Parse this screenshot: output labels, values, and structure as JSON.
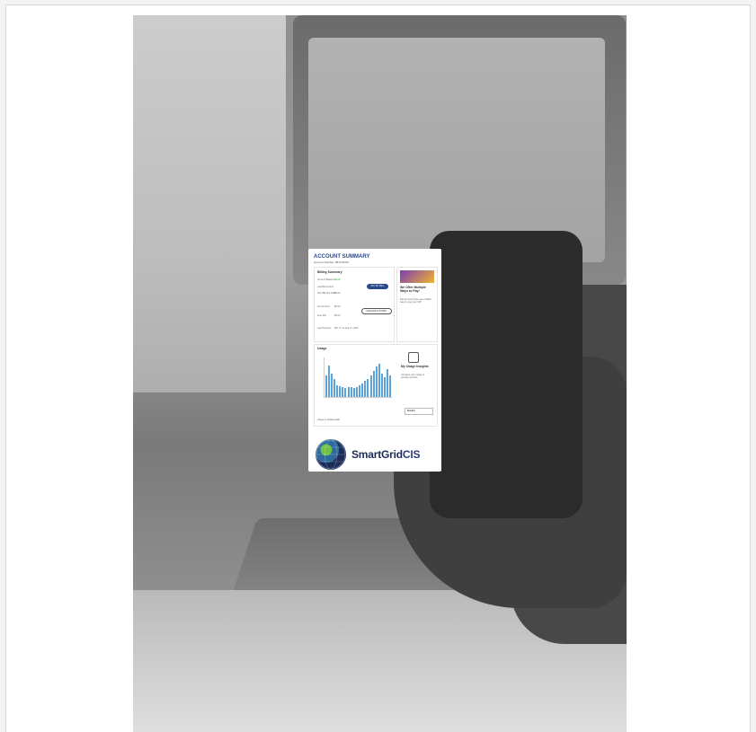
{
  "phone_app": {
    "title": "ACCOUNT SUMMARY",
    "account_number": "Account Number: 987100301",
    "billing": {
      "heading": "Billing Summary",
      "account_balance_label": "Account Balance",
      "account_balance_value": "$0.00",
      "last_bill_label": "Last Bill Amount",
      "last_bill_value": "$0.00",
      "next_due_label": "Next Bill Due Date",
      "pay_button": "PAY MY BILL",
      "due_amount_label": "Amount Due",
      "due_amount_value": "$0.00",
      "autopay_label": "Auto Pay",
      "autopay_value": "$0.00",
      "autopay_button": "MANAGE AUTOPAY",
      "last_payment_label": "Last Payment",
      "last_payment_value": "$27.77 on Aug 17, 2023"
    },
    "promo": {
      "heading": "We Offer Multiple Ways to Pay!",
      "body": "Did you know there are multiple ways to pay your bill?"
    },
    "usage": {
      "heading": "Usage",
      "insights_heading": "My Usage Insights",
      "insights_body": "Compare your usage to previous periods.",
      "footer_note": "Usage is updated daily",
      "dropdown_value": "Monthly"
    },
    "brand": {
      "name_part1": "SmartGrid",
      "name_part2": "CIS"
    }
  },
  "chart_data": {
    "type": "bar",
    "categories": [
      "1",
      "2",
      "3",
      "4",
      "5",
      "6",
      "7",
      "8",
      "9",
      "10",
      "11",
      "12",
      "13",
      "14",
      "15",
      "16",
      "17",
      "18",
      "19",
      "20",
      "21",
      "22",
      "23",
      "24"
    ],
    "series": [
      {
        "values": [
          55,
          80,
          60,
          45,
          30,
          28,
          25,
          22,
          24,
          25,
          22,
          24,
          30,
          35,
          40,
          45,
          55,
          65,
          78,
          85,
          60,
          50,
          70,
          55
        ]
      }
    ],
    "ylim": [
      0,
      100
    ]
  },
  "colors": {
    "brand_blue": "#2b4a8b",
    "bar_blue": "#5ba3d9",
    "accent_green": "#6ec047"
  }
}
